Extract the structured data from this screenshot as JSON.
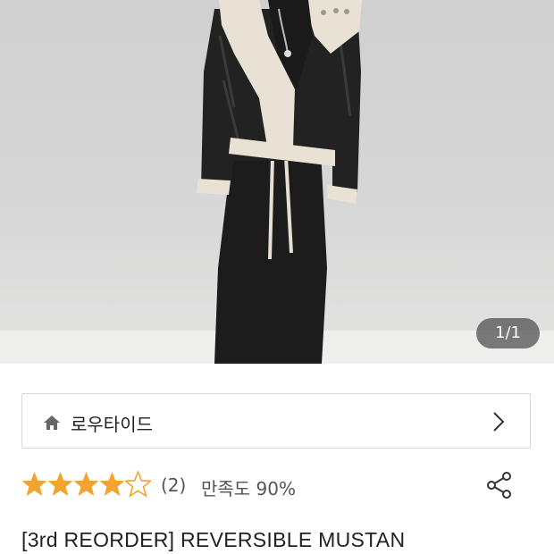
{
  "product": {
    "image_counter": "1/1",
    "shop_name": "로우타이드",
    "rating_stars": 4,
    "rating_max": 5,
    "review_count": "(2)",
    "satisfaction": "만족도 90%",
    "title": "[3rd REORDER] REVERSIBLE MUSTAN"
  },
  "icons": {
    "shop": "home-icon",
    "navigate": "chevron-right-icon",
    "share": "share-icon",
    "star_filled": "star-filled-icon",
    "star_empty": "star-empty-icon"
  },
  "colors": {
    "star": "#f2a42e",
    "text": "#222222",
    "muted": "#555555",
    "border": "#d9d9d9"
  }
}
